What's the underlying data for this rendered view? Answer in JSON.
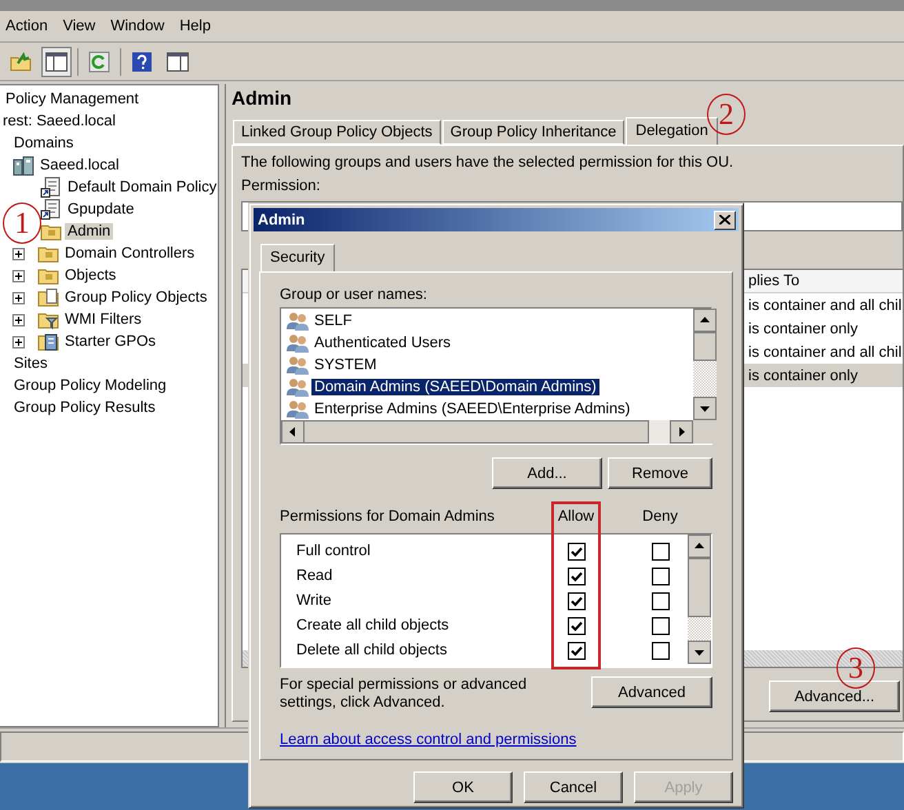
{
  "menu": [
    "Action",
    "View",
    "Window",
    "Help"
  ],
  "tree": [
    {
      "label": "Policy Management",
      "selected": false,
      "children": [
        {
          "label": "rest: Saeed.local",
          "selected": false,
          "children": [
            {
              "label": "Domains",
              "selected": false,
              "children": [
                {
                  "label": "Saeed.local",
                  "kind": "domain",
                  "selected": false,
                  "children": [
                    {
                      "label": "Default Domain Policy",
                      "kind": "link",
                      "selected": false
                    },
                    {
                      "label": "Gpupdate",
                      "kind": "link",
                      "selected": false
                    },
                    {
                      "label": "Admin",
                      "kind": "unit",
                      "selected": true
                    },
                    {
                      "label": "Domain Controllers",
                      "kind": "unit",
                      "selected": false,
                      "expanded": false
                    },
                    {
                      "label": "Objects",
                      "kind": "unit",
                      "selected": false,
                      "expanded": false
                    },
                    {
                      "label": "Group Policy Objects",
                      "kind": "container",
                      "selected": false,
                      "expanded": false
                    },
                    {
                      "label": "WMI Filters",
                      "kind": "filters",
                      "selected": false,
                      "expanded": false
                    },
                    {
                      "label": "Starter GPOs",
                      "kind": "starter",
                      "selected": false,
                      "expanded": false
                    }
                  ]
                }
              ]
            },
            {
              "label": "Sites",
              "selected": false
            },
            {
              "label": "Group Policy Modeling",
              "selected": false
            },
            {
              "label": "Group Policy Results",
              "selected": false
            }
          ]
        }
      ]
    }
  ],
  "details": {
    "title": "Admin",
    "tabs": [
      {
        "label": "Linked Group Policy Objects",
        "selected": false
      },
      {
        "label": "Group Policy Inheritance",
        "selected": false
      },
      {
        "label": "Delegation",
        "selected": true
      }
    ],
    "description": "The following groups and users have the selected permission for this OU.",
    "permission_label": "Permission:",
    "column_header": "plies To",
    "rows": [
      {
        "applies_to": "is container and all chil",
        "selected": false
      },
      {
        "applies_to": "is container only",
        "selected": false
      },
      {
        "applies_to": "is container and all chil",
        "selected": false
      },
      {
        "applies_to": "is container only",
        "selected": true
      }
    ],
    "advanced_button": "Advanced..."
  },
  "dialog": {
    "title": "Admin",
    "tabs": [
      {
        "label": "Security",
        "selected": true
      }
    ],
    "groups_label": "Group or user names:",
    "principals": [
      {
        "name": "SELF",
        "selected": false
      },
      {
        "name": "Authenticated Users",
        "selected": false
      },
      {
        "name": "SYSTEM",
        "selected": false
      },
      {
        "name": "Domain Admins (SAEED\\Domain Admins)",
        "selected": true
      },
      {
        "name": "Enterprise Admins (SAEED\\Enterprise Admins)",
        "selected": false
      }
    ],
    "add_button": "Add...",
    "remove_button": "Remove",
    "permissions_label": "Permissions for Domain Admins",
    "columns": [
      {
        "label": "Allow",
        "highlighted": true
      },
      {
        "label": "Deny",
        "highlighted": false
      }
    ],
    "permissions": [
      {
        "name": "Full control",
        "allow": true,
        "deny": false
      },
      {
        "name": "Read",
        "allow": true,
        "deny": false
      },
      {
        "name": "Write",
        "allow": true,
        "deny": false
      },
      {
        "name": "Create all child objects",
        "allow": true,
        "deny": false
      },
      {
        "name": "Delete all child objects",
        "allow": true,
        "deny": false
      }
    ],
    "advanced_note": "For special permissions or advanced settings, click Advanced.",
    "advanced_button": "Advanced",
    "help_link": "Learn about access control and permissions",
    "buttons": [
      {
        "label": "OK",
        "disabled": false
      },
      {
        "label": "Cancel",
        "disabled": false
      },
      {
        "label": "Apply",
        "disabled": true
      }
    ]
  },
  "annotations": [
    {
      "text": "1"
    },
    {
      "text": "2"
    },
    {
      "text": "3"
    }
  ]
}
